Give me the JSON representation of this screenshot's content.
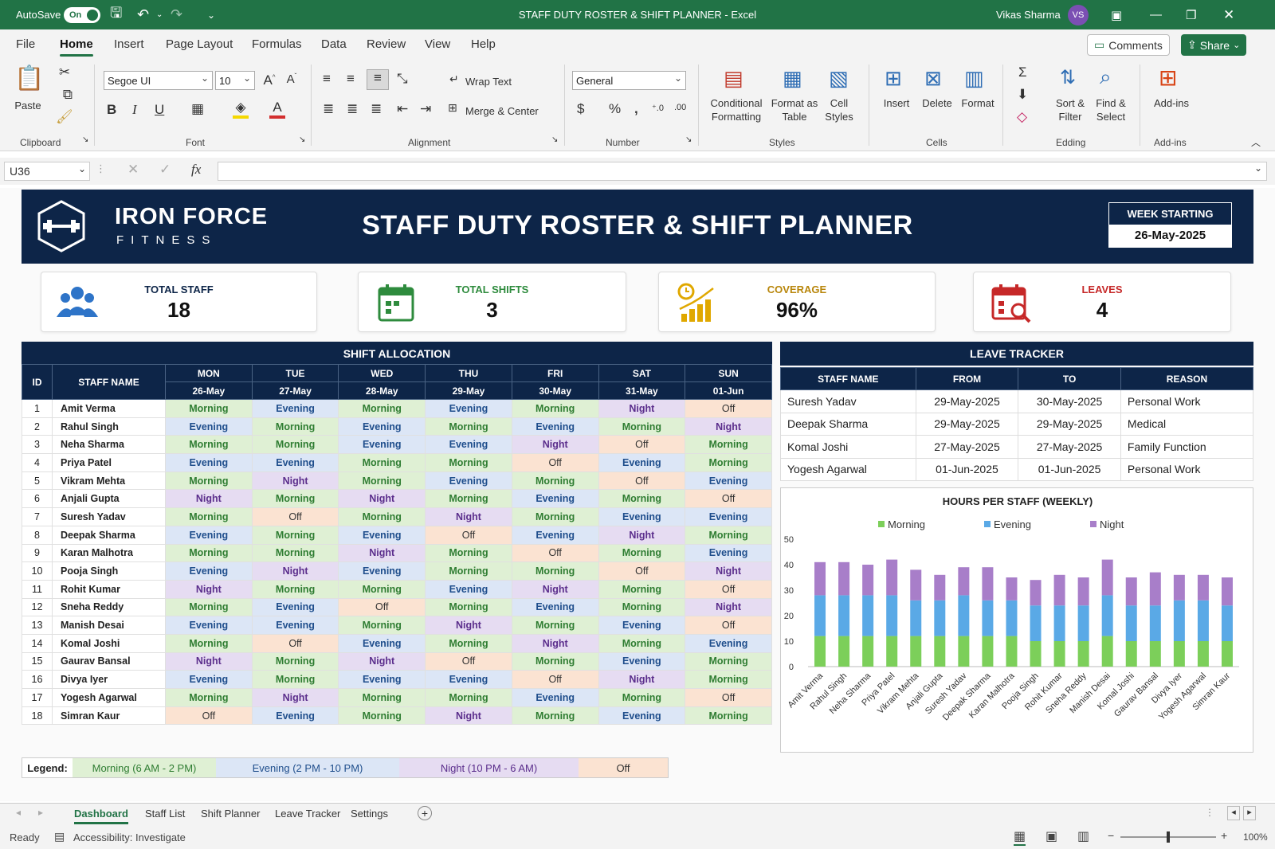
{
  "titlebar": {
    "autosave": "AutoSave",
    "toggle": "On",
    "title": "STAFF DUTY ROSTER & SHIFT PLANNER  -  Excel",
    "user": "Vikas Sharma",
    "initials": "VS"
  },
  "menu": {
    "items": [
      "File",
      "Home",
      "Insert",
      "Page Layout",
      "Formulas",
      "Data",
      "Review",
      "View",
      "Help"
    ],
    "active": "Home",
    "comments": "Comments",
    "share": "Share"
  },
  "ribbon": {
    "paste": "Paste",
    "clipboard": "Clipboard",
    "font_name": "Segoe UI",
    "font_size": "10",
    "font": "Font",
    "wrap_text": "Wrap Text",
    "merge_center": "Merge & Center",
    "alignment": "Alignment",
    "number_format": "General",
    "number": "Number",
    "conditional": "Conditional\nFormatting",
    "format_table": "Format as\nTable",
    "cell_styles": "Cell\nStyles",
    "styles": "Styles",
    "insert": "Insert",
    "delete": "Delete",
    "format": "Format",
    "cells": "Cells",
    "sort_filter": "Sort &\nFilter",
    "find_select": "Find &\nSelect",
    "editing": "Edding",
    "addins": "Add-ins",
    "addins_group": "Add-ins"
  },
  "formula_bar": {
    "name_box": "U36",
    "fx": "fx",
    "content": ""
  },
  "banner": {
    "logo_line1": "IRON FORCE",
    "logo_line2": "FITNESS",
    "title": "STAFF DUTY ROSTER & SHIFT PLANNER",
    "week_label": "WEEK STARTING",
    "week_value": "26-May-2025"
  },
  "kpis": [
    {
      "label": "TOTAL STAFF",
      "value": "18",
      "color": "#0d2548",
      "icon": "users-icon"
    },
    {
      "label": "TOTAL SHIFTS",
      "value": "3",
      "color": "#2e8b3d",
      "icon": "calendar-icon"
    },
    {
      "label": "COVERAGE",
      "value": "96%",
      "color": "#b8860b",
      "icon": "coverage-chart-icon"
    },
    {
      "label": "LEAVES",
      "value": "4",
      "color": "#c62828",
      "icon": "calendar-search-icon"
    }
  ],
  "shift_allocation": {
    "title": "SHIFT ALLOCATION",
    "id_header": "ID",
    "name_header": "STAFF NAME",
    "days": [
      {
        "day": "MON",
        "date": "26-May"
      },
      {
        "day": "TUE",
        "date": "27-May"
      },
      {
        "day": "WED",
        "date": "28-May"
      },
      {
        "day": "THU",
        "date": "29-May"
      },
      {
        "day": "FRI",
        "date": "30-May"
      },
      {
        "day": "SAT",
        "date": "31-May"
      },
      {
        "day": "SUN",
        "date": "01-Jun"
      }
    ],
    "rows": [
      {
        "id": "1",
        "name": "Amit Verma",
        "shifts": [
          "Morning",
          "Evening",
          "Morning",
          "Evening",
          "Morning",
          "Night",
          "Off"
        ]
      },
      {
        "id": "2",
        "name": "Rahul Singh",
        "shifts": [
          "Evening",
          "Morning",
          "Evening",
          "Morning",
          "Evening",
          "Morning",
          "Night"
        ]
      },
      {
        "id": "3",
        "name": "Neha Sharma",
        "shifts": [
          "Morning",
          "Morning",
          "Evening",
          "Evening",
          "Night",
          "Off",
          "Morning"
        ]
      },
      {
        "id": "4",
        "name": "Priya Patel",
        "shifts": [
          "Evening",
          "Evening",
          "Morning",
          "Morning",
          "Off",
          "Evening",
          "Morning"
        ]
      },
      {
        "id": "5",
        "name": "Vikram Mehta",
        "shifts": [
          "Morning",
          "Night",
          "Morning",
          "Evening",
          "Morning",
          "Off",
          "Evening"
        ]
      },
      {
        "id": "6",
        "name": "Anjali Gupta",
        "shifts": [
          "Night",
          "Morning",
          "Night",
          "Morning",
          "Evening",
          "Morning",
          "Off"
        ]
      },
      {
        "id": "7",
        "name": "Suresh Yadav",
        "shifts": [
          "Morning",
          "Off",
          "Morning",
          "Night",
          "Morning",
          "Evening",
          "Evening"
        ]
      },
      {
        "id": "8",
        "name": "Deepak Sharma",
        "shifts": [
          "Evening",
          "Morning",
          "Evening",
          "Off",
          "Evening",
          "Night",
          "Morning"
        ]
      },
      {
        "id": "9",
        "name": "Karan Malhotra",
        "shifts": [
          "Morning",
          "Morning",
          "Night",
          "Morning",
          "Off",
          "Morning",
          "Evening"
        ]
      },
      {
        "id": "10",
        "name": "Pooja Singh",
        "shifts": [
          "Evening",
          "Night",
          "Evening",
          "Morning",
          "Morning",
          "Off",
          "Night"
        ]
      },
      {
        "id": "11",
        "name": "Rohit Kumar",
        "shifts": [
          "Night",
          "Morning",
          "Morning",
          "Evening",
          "Night",
          "Morning",
          "Off"
        ]
      },
      {
        "id": "12",
        "name": "Sneha Reddy",
        "shifts": [
          "Morning",
          "Evening",
          "Off",
          "Morning",
          "Evening",
          "Morning",
          "Night"
        ]
      },
      {
        "id": "13",
        "name": "Manish Desai",
        "shifts": [
          "Evening",
          "Evening",
          "Morning",
          "Night",
          "Morning",
          "Evening",
          "Off"
        ]
      },
      {
        "id": "14",
        "name": "Komal Joshi",
        "shifts": [
          "Morning",
          "Off",
          "Evening",
          "Morning",
          "Night",
          "Morning",
          "Evening"
        ]
      },
      {
        "id": "15",
        "name": "Gaurav Bansal",
        "shifts": [
          "Night",
          "Morning",
          "Night",
          "Off",
          "Morning",
          "Evening",
          "Morning"
        ]
      },
      {
        "id": "16",
        "name": "Divya Iyer",
        "shifts": [
          "Evening",
          "Morning",
          "Evening",
          "Evening",
          "Off",
          "Night",
          "Morning"
        ]
      },
      {
        "id": "17",
        "name": "Yogesh Agarwal",
        "shifts": [
          "Morning",
          "Night",
          "Morning",
          "Morning",
          "Evening",
          "Morning",
          "Off"
        ]
      },
      {
        "id": "18",
        "name": "Simran Kaur",
        "shifts": [
          "Off",
          "Evening",
          "Morning",
          "Night",
          "Morning",
          "Evening",
          "Morning"
        ]
      }
    ]
  },
  "leave_tracker": {
    "title": "LEAVE TRACKER",
    "headers": [
      "STAFF NAME",
      "FROM",
      "TO",
      "REASON"
    ],
    "rows": [
      [
        "Suresh Yadav",
        "29-May-2025",
        "30-May-2025",
        "Personal Work"
      ],
      [
        "Deepak Sharma",
        "29-May-2025",
        "29-May-2025",
        "Medical"
      ],
      [
        "Komal Joshi",
        "27-May-2025",
        "27-May-2025",
        "Family Function"
      ],
      [
        "Yogesh Agarwal",
        "01-Jun-2025",
        "01-Jun-2025",
        "Personal Work"
      ]
    ]
  },
  "chart_data": {
    "type": "bar",
    "stacked": true,
    "title": "HOURS PER STAFF (WEEKLY)",
    "legend_position": "top",
    "ylim": [
      0,
      50
    ],
    "yticks": [
      0,
      10,
      20,
      30,
      40,
      50
    ],
    "categories": [
      "Amit Verma",
      "Rahul Singh",
      "Neha Sharma",
      "Priya Patel",
      "Vikram Mehta",
      "Anjali Gupta",
      "Suresh Yadav",
      "Deepak Sharma",
      "Karan Malhotra",
      "Pooja Singh",
      "Rohit Kumar",
      "Sneha Reddy",
      "Manish Desai",
      "Komal Joshi",
      "Gaurav Bansal",
      "Divya Iyer",
      "Yogesh Agarwal",
      "Simran Kaur"
    ],
    "series": [
      {
        "name": "Morning",
        "color": "#7ccf5a",
        "values": [
          12,
          12,
          12,
          12,
          12,
          12,
          12,
          12,
          12,
          10,
          10,
          10,
          12,
          10,
          10,
          10,
          10,
          10
        ]
      },
      {
        "name": "Evening",
        "color": "#5aa9e6",
        "values": [
          16,
          16,
          16,
          16,
          14,
          14,
          16,
          14,
          14,
          14,
          14,
          14,
          16,
          14,
          14,
          16,
          16,
          14
        ]
      },
      {
        "name": "Night",
        "color": "#a87ec9",
        "values": [
          13,
          13,
          12,
          14,
          12,
          10,
          11,
          13,
          9,
          10,
          12,
          11,
          14,
          11,
          13,
          10,
          10,
          11
        ]
      }
    ]
  },
  "legend": {
    "label": "Legend:",
    "items": [
      {
        "text": "Morning (6 AM - 2 PM)",
        "bg": "#dff0d4",
        "color": "#2f7d32"
      },
      {
        "text": "Evening (2 PM - 10 PM)",
        "bg": "#dce6f6",
        "color": "#1f4e8c"
      },
      {
        "text": "Night (10 PM - 6 AM)",
        "bg": "#e6dcf2",
        "color": "#5b2e8c"
      },
      {
        "text": "Off",
        "bg": "#fbe3d2",
        "color": "#333"
      }
    ]
  },
  "sheet_tabs": {
    "tabs": [
      "Dashboard",
      "Staff List",
      "Shift Planner",
      "Leave Tracker",
      "Settings"
    ],
    "active": "Dashboard"
  },
  "status": {
    "ready": "Ready",
    "accessibility": "Accessibility: Investigate",
    "zoom": "100%"
  }
}
